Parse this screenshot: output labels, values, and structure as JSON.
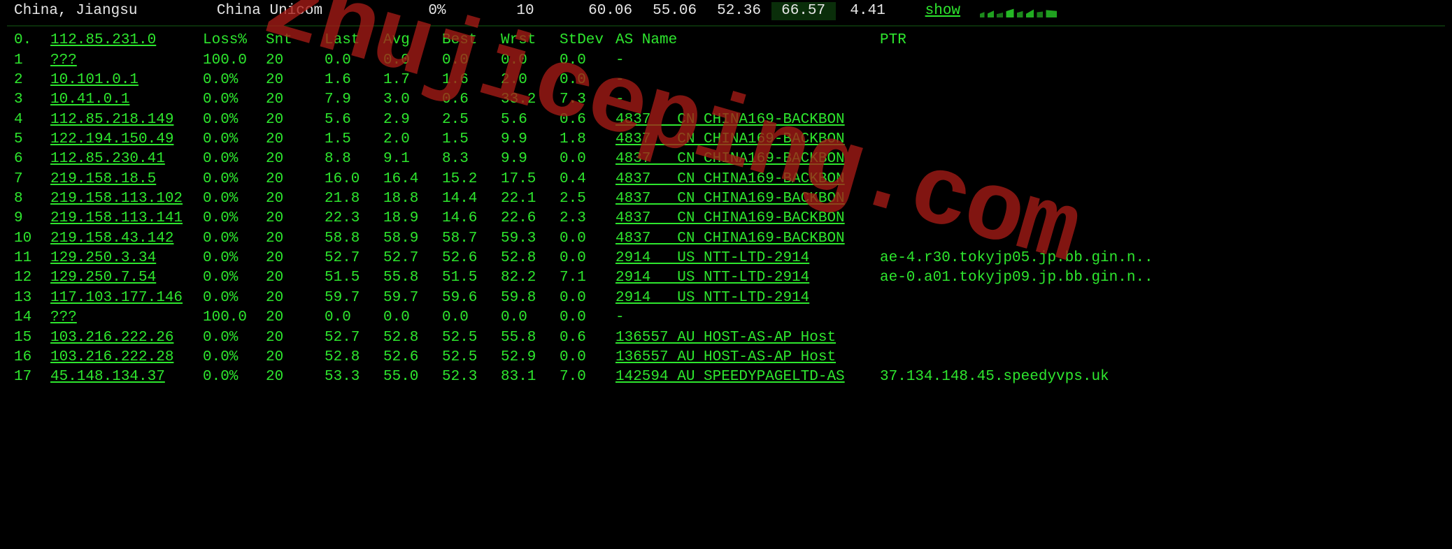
{
  "header": {
    "location": "China, Jiangsu",
    "provider": "China Unicom",
    "loss_pct": "0%",
    "count": "10",
    "cells": [
      "60.06",
      "55.06",
      "52.36",
      "66.57",
      "4.41"
    ],
    "highlight_index": 3,
    "show_label": "show"
  },
  "columns": {
    "hop": "0.",
    "ip": "112.85.231.0",
    "loss": "Loss%",
    "snt": "Snt",
    "last": "Last",
    "avg": "Avg",
    "best": "Best",
    "wrst": "Wrst",
    "stdev": "StDev",
    "asname": "AS Name",
    "ptr": "PTR"
  },
  "rows": [
    {
      "hop": "1",
      "ip": "???",
      "loss": "100.0",
      "snt": "20",
      "last": "0.0",
      "avg": "0.0",
      "best": "0.0",
      "wrst": "0.0",
      "stdev": "0.0",
      "as": "-",
      "ptr": ""
    },
    {
      "hop": "2",
      "ip": "10.101.0.1",
      "loss": "0.0%",
      "snt": "20",
      "last": "1.6",
      "avg": "1.7",
      "best": "1.6",
      "wrst": "2.0",
      "stdev": "0.0",
      "as": "-",
      "ptr": ""
    },
    {
      "hop": "3",
      "ip": "10.41.0.1",
      "loss": "0.0%",
      "snt": "20",
      "last": "7.9",
      "avg": "3.0",
      "best": "0.6",
      "wrst": "33.2",
      "stdev": "7.3",
      "as": "-",
      "ptr": ""
    },
    {
      "hop": "4",
      "ip": "112.85.218.149",
      "loss": "0.0%",
      "snt": "20",
      "last": "5.6",
      "avg": "2.9",
      "best": "2.5",
      "wrst": "5.6",
      "stdev": "0.6",
      "as": "4837   CN CHINA169-BACKBON",
      "ptr": ""
    },
    {
      "hop": "5",
      "ip": "122.194.150.49",
      "loss": "0.0%",
      "snt": "20",
      "last": "1.5",
      "avg": "2.0",
      "best": "1.5",
      "wrst": "9.9",
      "stdev": "1.8",
      "as": "4837   CN CHINA169-BACKBON",
      "ptr": ""
    },
    {
      "hop": "6",
      "ip": "112.85.230.41",
      "loss": "0.0%",
      "snt": "20",
      "last": "8.8",
      "avg": "9.1",
      "best": "8.3",
      "wrst": "9.9",
      "stdev": "0.0",
      "as": "4837   CN CHINA169-BACKBON",
      "ptr": ""
    },
    {
      "hop": "7",
      "ip": "219.158.18.5",
      "loss": "0.0%",
      "snt": "20",
      "last": "16.0",
      "avg": "16.4",
      "best": "15.2",
      "wrst": "17.5",
      "stdev": "0.4",
      "as": "4837   CN CHINA169-BACKBON",
      "ptr": ""
    },
    {
      "hop": "8",
      "ip": "219.158.113.102",
      "loss": "0.0%",
      "snt": "20",
      "last": "21.8",
      "avg": "18.8",
      "best": "14.4",
      "wrst": "22.1",
      "stdev": "2.5",
      "as": "4837   CN CHINA169-BACKBON",
      "ptr": ""
    },
    {
      "hop": "9",
      "ip": "219.158.113.141",
      "loss": "0.0%",
      "snt": "20",
      "last": "22.3",
      "avg": "18.9",
      "best": "14.6",
      "wrst": "22.6",
      "stdev": "2.3",
      "as": "4837   CN CHINA169-BACKBON",
      "ptr": ""
    },
    {
      "hop": "10",
      "ip": "219.158.43.142",
      "loss": "0.0%",
      "snt": "20",
      "last": "58.8",
      "avg": "58.9",
      "best": "58.7",
      "wrst": "59.3",
      "stdev": "0.0",
      "as": "4837   CN CHINA169-BACKBON",
      "ptr": ""
    },
    {
      "hop": "11",
      "ip": "129.250.3.34",
      "loss": "0.0%",
      "snt": "20",
      "last": "52.7",
      "avg": "52.7",
      "best": "52.6",
      "wrst": "52.8",
      "stdev": "0.0",
      "as": "2914   US NTT-LTD-2914",
      "ptr": "ae-4.r30.tokyjp05.jp.bb.gin.n.."
    },
    {
      "hop": "12",
      "ip": "129.250.7.54",
      "loss": "0.0%",
      "snt": "20",
      "last": "51.5",
      "avg": "55.8",
      "best": "51.5",
      "wrst": "82.2",
      "stdev": "7.1",
      "as": "2914   US NTT-LTD-2914",
      "ptr": "ae-0.a01.tokyjp09.jp.bb.gin.n.."
    },
    {
      "hop": "13",
      "ip": "117.103.177.146",
      "loss": "0.0%",
      "snt": "20",
      "last": "59.7",
      "avg": "59.7",
      "best": "59.6",
      "wrst": "59.8",
      "stdev": "0.0",
      "as": "2914   US NTT-LTD-2914",
      "ptr": ""
    },
    {
      "hop": "14",
      "ip": "???",
      "loss": "100.0",
      "snt": "20",
      "last": "0.0",
      "avg": "0.0",
      "best": "0.0",
      "wrst": "0.0",
      "stdev": "0.0",
      "as": "-",
      "ptr": ""
    },
    {
      "hop": "15",
      "ip": "103.216.222.26",
      "loss": "0.0%",
      "snt": "20",
      "last": "52.7",
      "avg": "52.8",
      "best": "52.5",
      "wrst": "55.8",
      "stdev": "0.6",
      "as": "136557 AU HOST-AS-AP Host",
      "ptr": ""
    },
    {
      "hop": "16",
      "ip": "103.216.222.28",
      "loss": "0.0%",
      "snt": "20",
      "last": "52.8",
      "avg": "52.6",
      "best": "52.5",
      "wrst": "52.9",
      "stdev": "0.0",
      "as": "136557 AU HOST-AS-AP Host",
      "ptr": ""
    },
    {
      "hop": "17",
      "ip": "45.148.134.37",
      "loss": "0.0%",
      "snt": "20",
      "last": "53.3",
      "avg": "55.0",
      "best": "52.3",
      "wrst": "83.1",
      "stdev": "7.0",
      "as": "142594 AU SPEEDYPAGELTD-AS",
      "ptr": "37.134.148.45.speedyvps.uk"
    }
  ],
  "watermark": "zhujiceping.com"
}
